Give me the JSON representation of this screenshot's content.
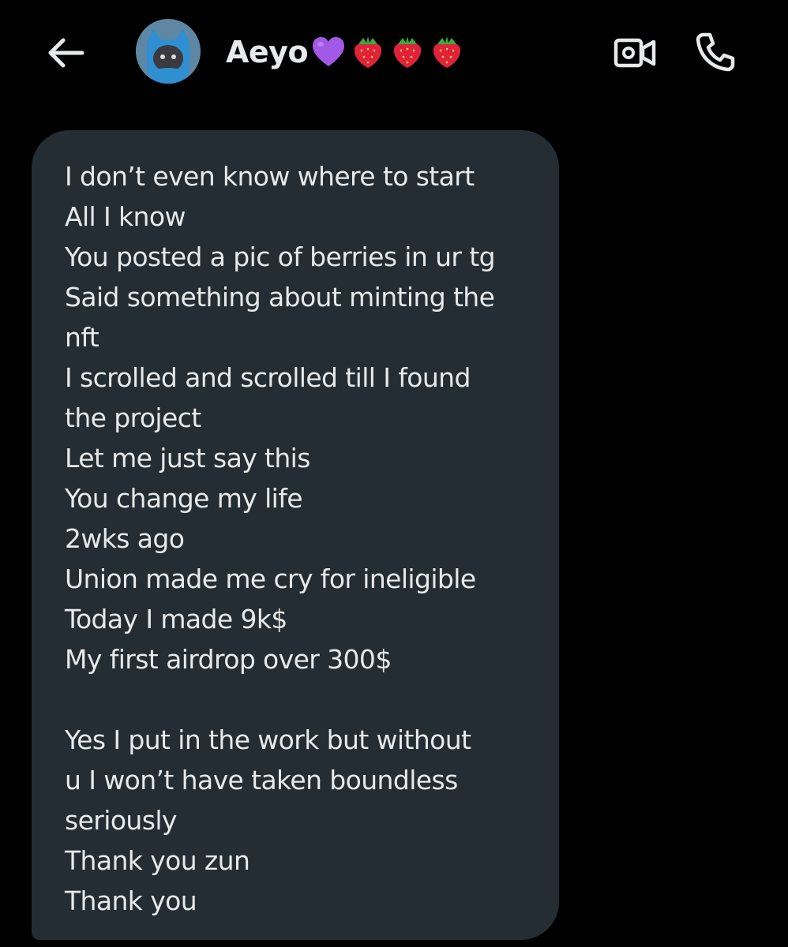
{
  "header": {
    "back_icon": "arrow-left-icon",
    "contact_name": "Aeyo",
    "name_emojis": [
      "purple-heart-icon",
      "strawberry-icon",
      "strawberry-icon",
      "strawberry-icon"
    ],
    "video_icon": "video-camera-icon",
    "call_icon": "phone-icon"
  },
  "message": {
    "lines": [
      "I don’t even know where to start",
      "All I know",
      "You posted a pic of berries in ur tg",
      "Said something about minting the",
      "nft",
      "I scrolled and scrolled till I found",
      "the project",
      "Let me just say this",
      "You change my life",
      "2wks ago",
      "Union made me cry for ineligible",
      "Today I made 9k$",
      "My first airdrop over 300$",
      "",
      "Yes I put in the work but without",
      "u I won’t have taken boundless",
      "seriously",
      "Thank you zun",
      "Thank you"
    ]
  },
  "colors": {
    "background": "#000000",
    "bubble": "#242d34",
    "text": "#e7e9ea",
    "heart": "#a259e6",
    "strawberry": "#e0233a"
  }
}
